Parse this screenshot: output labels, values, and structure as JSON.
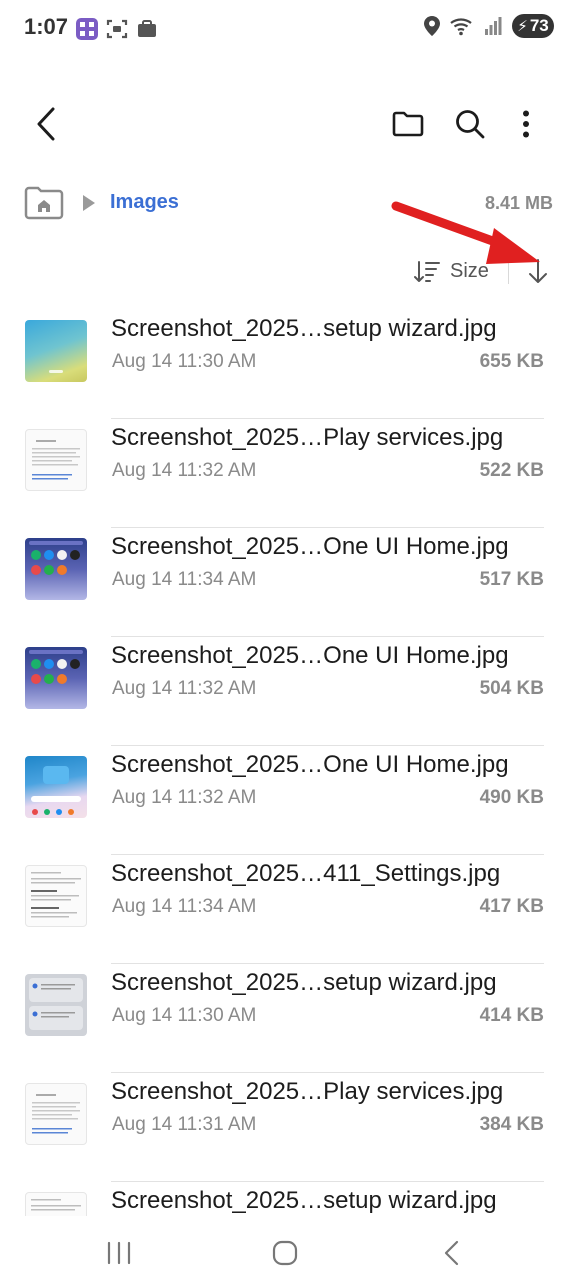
{
  "status_bar": {
    "time": "1:07",
    "battery": "73"
  },
  "breadcrumb": {
    "current": "Images",
    "total_size": "8.41 MB"
  },
  "sort": {
    "label": "Size"
  },
  "files": [
    {
      "name": "Screenshot_2025…setup wizard.jpg",
      "date": "Aug 14 11:30 AM",
      "size": "655 KB",
      "thumb": "wizard"
    },
    {
      "name": "Screenshot_2025…Play services.jpg",
      "date": "Aug 14 11:32 AM",
      "size": "522 KB",
      "thumb": "doc"
    },
    {
      "name": "Screenshot_2025…One UI Home.jpg",
      "date": "Aug 14 11:34 AM",
      "size": "517 KB",
      "thumb": "home"
    },
    {
      "name": "Screenshot_2025…One UI Home.jpg",
      "date": "Aug 14 11:32 AM",
      "size": "504 KB",
      "thumb": "home"
    },
    {
      "name": "Screenshot_2025…One UI Home.jpg",
      "date": "Aug 14 11:32 AM",
      "size": "490 KB",
      "thumb": "home2"
    },
    {
      "name": "Screenshot_2025…411_Settings.jpg",
      "date": "Aug 14 11:34 AM",
      "size": "417 KB",
      "thumb": "settings"
    },
    {
      "name": "Screenshot_2025…setup wizard.jpg",
      "date": "Aug 14 11:30 AM",
      "size": "414 KB",
      "thumb": "gray"
    },
    {
      "name": "Screenshot_2025…Play services.jpg",
      "date": "Aug 14 11:31 AM",
      "size": "384 KB",
      "thumb": "doc"
    },
    {
      "name": "Screenshot_2025…setup wizard.jpg",
      "date": "",
      "size": "",
      "thumb": "settings"
    }
  ],
  "colors": {
    "accent": "#3b6fd4",
    "annotation_arrow": "#e02020"
  }
}
